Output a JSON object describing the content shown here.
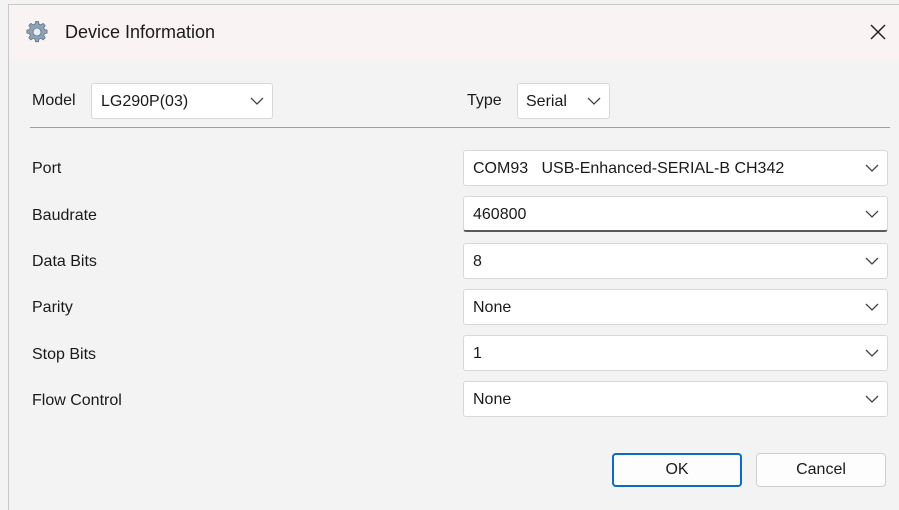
{
  "window": {
    "title": "Device Information"
  },
  "header": {
    "model_label": "Model",
    "model_value": "LG290P(03)",
    "type_label": "Type",
    "type_value": "Serial"
  },
  "settings": [
    {
      "label": "Port",
      "value": "COM93   USB-Enhanced-SERIAL-B CH342"
    },
    {
      "label": "Baudrate",
      "value": "460800"
    },
    {
      "label": "Data Bits",
      "value": "8"
    },
    {
      "label": "Parity",
      "value": "None"
    },
    {
      "label": "Stop Bits",
      "value": "1"
    },
    {
      "label": "Flow Control",
      "value": "None"
    }
  ],
  "buttons": {
    "ok": "OK",
    "cancel": "Cancel"
  },
  "icons": {
    "app": "gear-icon",
    "close": "close-icon",
    "dropdown": "chevron-down-icon"
  },
  "colors": {
    "accent": "#0f6cbd",
    "titlebar": "#faf3f3",
    "background": "#f3f3f3"
  }
}
